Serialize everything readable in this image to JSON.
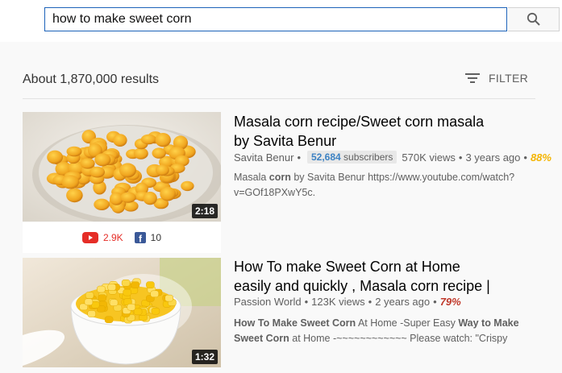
{
  "search": {
    "query": "how to make sweet corn"
  },
  "results_header": {
    "count": "About 1,870,000 results",
    "filter_label": "FILTER"
  },
  "results": [
    {
      "title": "Masala corn recipe/Sweet corn masala by Savita Benur",
      "channel": "Savita Benur",
      "subscribers_count": "52,684",
      "subscribers_label": "subscribers",
      "views": "570K views",
      "age": "3 years ago",
      "rating": "88%",
      "rating_color": "#f4b400",
      "description_parts": [
        "Masala ",
        "corn",
        " by Savita Benur https://www.youtube.com/watch?v=GOf18PXwY5c."
      ],
      "duration": "2:18",
      "youtube_shares": "2.9K",
      "facebook_shares": "10"
    },
    {
      "title": "How To make Sweet Corn at Home easily and quickly , Masala corn recipe |",
      "channel": "Passion World",
      "views": "123K views",
      "age": "2 years ago",
      "rating": "79%",
      "rating_color": "#c0392b",
      "description_parts": [
        "How To Make Sweet Corn",
        " At Home -Super Easy ",
        "Way to Make Sweet Corn",
        " at Home -~~~~~~~~~~~~ Please watch: \"Crispy"
      ],
      "duration": "1:32"
    }
  ]
}
